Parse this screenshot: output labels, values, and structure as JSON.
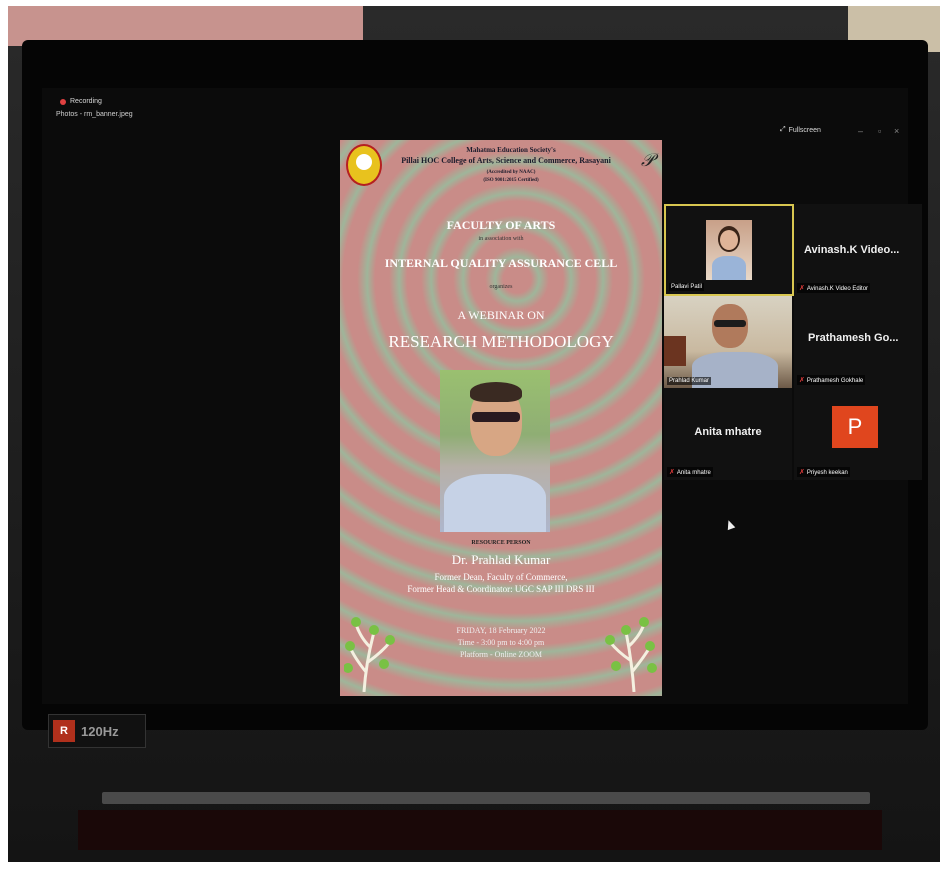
{
  "recording": {
    "label": "Recording"
  },
  "file": {
    "title": "Photos - rm_banner.jpeg"
  },
  "controls": {
    "fullscreen": "Fullscreen"
  },
  "poster": {
    "society": "Mahatma Education Society's",
    "college": "Pillai HOC College of Arts, Science and Commerce, Rasayani",
    "accredited": "(Accredited by NAAC)",
    "iso": "(ISO 9001:2015 Certified)",
    "faculty": "FACULTY OF ARTS",
    "association": "in association with",
    "iqac": "INTERNAL QUALITY ASSURANCE CELL",
    "organizes": "organizes",
    "webinar": "A WEBINAR ON",
    "topic": "RESEARCH METHODOLOGY",
    "resource_label": "RESOURCE PERSON",
    "speaker": "Dr. Prahlad Kumar",
    "role1": "Former Dean, Faculty of Commerce,",
    "role2": "Former Head & Coordinator: UGC SAP III DRS III",
    "date": "FRIDAY, 18 February 2022",
    "time": "Time - 3:00 pm to 4:00 pm",
    "platform": "Platform - Online ZOOM"
  },
  "participants": [
    {
      "name": "Pallavi Patil",
      "display": ""
    },
    {
      "name": "Avinash.K Video Editor",
      "display": "Avinash.K  Video..."
    },
    {
      "name": "Prahlad Kumar",
      "display": ""
    },
    {
      "name": "Prathamesh Gokhale",
      "display": "Prathamesh  Go..."
    },
    {
      "name": "Anita mhatre",
      "display": "Anita mhatre"
    },
    {
      "name": "Priyesh keekan",
      "display": "P"
    }
  ],
  "badge": {
    "hz": "120Hz",
    "logo": "R"
  },
  "colors": {
    "avatar_orange": "#e0461e",
    "active_border": "#d8c650"
  }
}
